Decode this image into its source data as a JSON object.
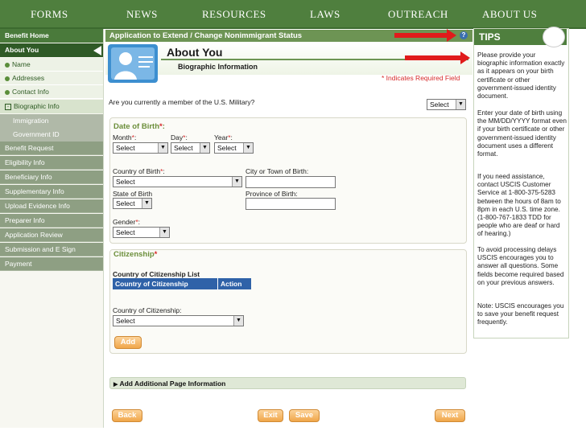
{
  "topnav": [
    "FORMS",
    "NEWS",
    "RESOURCES",
    "LAWS",
    "OUTREACH",
    "ABOUT US"
  ],
  "sidebar": {
    "home": "Benefit Home",
    "about": "About You",
    "sub_items": [
      "Name",
      "Addresses",
      "Contact Info"
    ],
    "bio": "Biographic Info",
    "nested": [
      "Immigration",
      "Government ID"
    ],
    "sections": [
      "Benefit Request",
      "Eligibility Info",
      "Beneficiary Info",
      "Supplementary Info",
      "Upload Evidence Info",
      "Preparer Info",
      "Application Review",
      "Submission and E Sign",
      "Payment"
    ]
  },
  "title_bar": "Application to Extend / Change Nonimmigrant Status",
  "help_icon": "?",
  "page_title": "About You",
  "page_subtitle": "Biographic Information",
  "required_note": "* Indicates Required Field",
  "military": {
    "question": "Are you currently a member of the U.S. Military?",
    "value": "Select"
  },
  "dob": {
    "heading": "Date of Birth",
    "month_label": "Month",
    "day_label": "Day",
    "year_label": "Year",
    "month_value": "Select",
    "day_value": "Select",
    "year_value": "Select"
  },
  "country_birth": {
    "label": "Country of Birth",
    "value": "Select"
  },
  "city_birth": {
    "label": "City or Town of Birth:",
    "value": ""
  },
  "state_birth": {
    "label": "State of Birth",
    "value": "Select"
  },
  "province_birth": {
    "label": "Province of Birth:",
    "value": ""
  },
  "gender": {
    "label": "Gender",
    "value": "Select"
  },
  "citizenship": {
    "heading": "Citizenship",
    "list_title": "Country of Citizenship List",
    "col1": "Country of Citizenship",
    "col2": "Action",
    "field_label": "Country of Citizenship:",
    "field_value": "Select",
    "add": "Add"
  },
  "add_page_info": "Add Additional Page Information",
  "expand_icon": "▶",
  "buttons": {
    "back": "Back",
    "exit": "Exit",
    "save": "Save",
    "next": "Next"
  },
  "tips": {
    "title": "TIPS",
    "paragraphs": [
      "Please provide your biographic information exactly as it appears on your birth certificate or other government-issued identity document.",
      "Enter your date of birth using the MM/DD/YYYY format even if your birth certificate or other government-issued identity document uses a different format.",
      "If you need assistance, contact USCIS Customer Service at 1-800-375-5283 between the hours of 8am to 8pm in each U.S. time zone. (1-800-767-1833 TDD for people who are deaf or hard of hearing.)",
      "To avoid processing delays USCIS encourages you to answer all questions. Some fields become required based on your previous answers.",
      "Note: USCIS encourages you to save your benefit request frequently."
    ]
  },
  "colors": {
    "nav_green": "#4f7f3e",
    "accent_orange": "#f0a64a",
    "required_red": "#d62a2a",
    "table_blue": "#2f62a8",
    "arrow_red": "#e01b1b"
  }
}
